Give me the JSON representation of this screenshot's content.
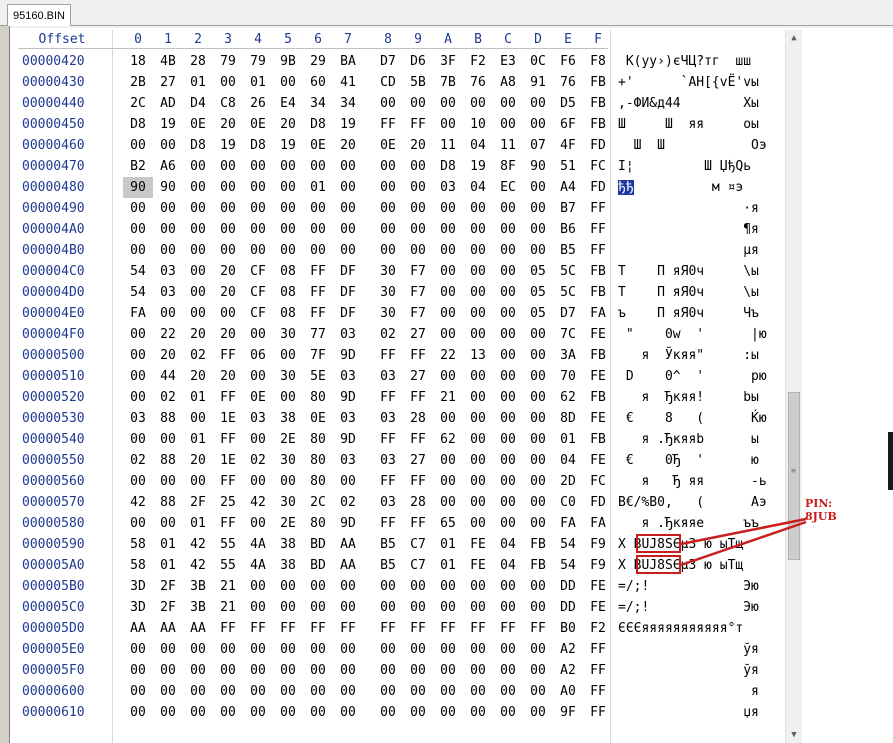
{
  "tab": {
    "label": "95160.BIN"
  },
  "header": {
    "offset_label": "Offset",
    "columns": [
      "0",
      "1",
      "2",
      "3",
      "4",
      "5",
      "6",
      "7",
      "8",
      "9",
      "A",
      "B",
      "C",
      "D",
      "E",
      "F"
    ]
  },
  "rows": [
    {
      "offset": "00000420",
      "bytes": [
        "18",
        "4B",
        "28",
        "79",
        "79",
        "9B",
        "29",
        "BA",
        "D7",
        "D6",
        "3F",
        "F2",
        "E3",
        "0C",
        "F6",
        "F8"
      ],
      "ascii": " K(yy›)єЧЦ?тг  шш"
    },
    {
      "offset": "00000430",
      "bytes": [
        "2B",
        "27",
        "01",
        "00",
        "01",
        "00",
        "60",
        "41",
        "CD",
        "5B",
        "7B",
        "76",
        "A8",
        "91",
        "76",
        "FB"
      ],
      "ascii": "+'      `AН[{vЁ'vы"
    },
    {
      "offset": "00000440",
      "bytes": [
        "2C",
        "AD",
        "D4",
        "C8",
        "26",
        "E4",
        "34",
        "34",
        "00",
        "00",
        "00",
        "00",
        "00",
        "00",
        "D5",
        "FB"
      ],
      "ascii": ",-ФИ&д44        Хы"
    },
    {
      "offset": "00000450",
      "bytes": [
        "D8",
        "19",
        "0E",
        "20",
        "0E",
        "20",
        "D8",
        "19",
        "FF",
        "FF",
        "00",
        "10",
        "00",
        "00",
        "6F",
        "FB"
      ],
      "ascii": "Ш     Ш  яя     оы"
    },
    {
      "offset": "00000460",
      "bytes": [
        "00",
        "00",
        "D8",
        "19",
        "D8",
        "19",
        "0E",
        "20",
        "0E",
        "20",
        "11",
        "04",
        "11",
        "07",
        "4F",
        "FD"
      ],
      "ascii": "  Ш  Ш           Оэ"
    },
    {
      "offset": "00000470",
      "bytes": [
        "B2",
        "A6",
        "00",
        "00",
        "00",
        "00",
        "00",
        "00",
        "00",
        "00",
        "D8",
        "19",
        "8F",
        "90",
        "51",
        "FC"
      ],
      "ascii": "І¦         Ш ЏђQь"
    },
    {
      "offset": "00000480",
      "bytes": [
        "90",
        "90",
        "00",
        "00",
        "00",
        "00",
        "01",
        "00",
        "00",
        "00",
        "03",
        "04",
        "EC",
        "00",
        "A4",
        "FD"
      ],
      "ascii": "ђђ          м ¤э"
    },
    {
      "offset": "00000490",
      "bytes": [
        "00",
        "00",
        "00",
        "00",
        "00",
        "00",
        "00",
        "00",
        "00",
        "00",
        "00",
        "00",
        "00",
        "00",
        "B7",
        "FF"
      ],
      "ascii": "                ·я"
    },
    {
      "offset": "000004A0",
      "bytes": [
        "00",
        "00",
        "00",
        "00",
        "00",
        "00",
        "00",
        "00",
        "00",
        "00",
        "00",
        "00",
        "00",
        "00",
        "B6",
        "FF"
      ],
      "ascii": "                ¶я"
    },
    {
      "offset": "000004B0",
      "bytes": [
        "00",
        "00",
        "00",
        "00",
        "00",
        "00",
        "00",
        "00",
        "00",
        "00",
        "00",
        "00",
        "00",
        "00",
        "B5",
        "FF"
      ],
      "ascii": "                µя"
    },
    {
      "offset": "000004C0",
      "bytes": [
        "54",
        "03",
        "00",
        "20",
        "CF",
        "08",
        "FF",
        "DF",
        "30",
        "F7",
        "00",
        "00",
        "00",
        "05",
        "5C",
        "FB"
      ],
      "ascii": "T    П яЯ0ч     \\ы"
    },
    {
      "offset": "000004D0",
      "bytes": [
        "54",
        "03",
        "00",
        "20",
        "CF",
        "08",
        "FF",
        "DF",
        "30",
        "F7",
        "00",
        "00",
        "00",
        "05",
        "5C",
        "FB"
      ],
      "ascii": "T    П яЯ0ч     \\ы"
    },
    {
      "offset": "000004E0",
      "bytes": [
        "FA",
        "00",
        "00",
        "00",
        "CF",
        "08",
        "FF",
        "DF",
        "30",
        "F7",
        "00",
        "00",
        "00",
        "05",
        "D7",
        "FA"
      ],
      "ascii": "ъ    П яЯ0ч     Чъ"
    },
    {
      "offset": "000004F0",
      "bytes": [
        "00",
        "22",
        "20",
        "20",
        "00",
        "30",
        "77",
        "03",
        "02",
        "27",
        "00",
        "00",
        "00",
        "00",
        "7C",
        "FE"
      ],
      "ascii": " \"    0w  '      |ю"
    },
    {
      "offset": "00000500",
      "bytes": [
        "00",
        "20",
        "02",
        "FF",
        "06",
        "00",
        "7F",
        "9D",
        "FF",
        "FF",
        "22",
        "13",
        "00",
        "00",
        "3A",
        "FB"
      ],
      "ascii": "   я  Ўкяя\"     :ы"
    },
    {
      "offset": "00000510",
      "bytes": [
        "00",
        "44",
        "20",
        "20",
        "00",
        "30",
        "5E",
        "03",
        "03",
        "27",
        "00",
        "00",
        "00",
        "00",
        "70",
        "FE"
      ],
      "ascii": " D    0^  '      рю"
    },
    {
      "offset": "00000520",
      "bytes": [
        "00",
        "02",
        "01",
        "FF",
        "0E",
        "00",
        "80",
        "9D",
        "FF",
        "FF",
        "21",
        "00",
        "00",
        "00",
        "62",
        "FB"
      ],
      "ascii": "   я  Ђкяя!     bы"
    },
    {
      "offset": "00000530",
      "bytes": [
        "03",
        "88",
        "00",
        "1E",
        "03",
        "38",
        "0E",
        "03",
        "03",
        "28",
        "00",
        "00",
        "00",
        "00",
        "8D",
        "FE"
      ],
      "ascii": " €    8   (      Ќю"
    },
    {
      "offset": "00000540",
      "bytes": [
        "00",
        "00",
        "01",
        "FF",
        "00",
        "2E",
        "80",
        "9D",
        "FF",
        "FF",
        "62",
        "00",
        "00",
        "00",
        "01",
        "FB"
      ],
      "ascii": "   я .Ђкяяb      ы"
    },
    {
      "offset": "00000550",
      "bytes": [
        "02",
        "88",
        "20",
        "1E",
        "02",
        "30",
        "80",
        "03",
        "03",
        "27",
        "00",
        "00",
        "00",
        "00",
        "04",
        "FE"
      ],
      "ascii": " €    0Ђ  '      ю"
    },
    {
      "offset": "00000560",
      "bytes": [
        "00",
        "00",
        "00",
        "FF",
        "00",
        "00",
        "80",
        "00",
        "FF",
        "FF",
        "00",
        "00",
        "00",
        "00",
        "2D",
        "FC"
      ],
      "ascii": "   я   Ђ яя      -ь"
    },
    {
      "offset": "00000570",
      "bytes": [
        "42",
        "88",
        "2F",
        "25",
        "42",
        "30",
        "2C",
        "02",
        "03",
        "28",
        "00",
        "00",
        "00",
        "00",
        "C0",
        "FD"
      ],
      "ascii": "B€/%B0,   (      Аэ"
    },
    {
      "offset": "00000580",
      "bytes": [
        "00",
        "00",
        "01",
        "FF",
        "00",
        "2E",
        "80",
        "9D",
        "FF",
        "FF",
        "65",
        "00",
        "00",
        "00",
        "FA",
        "FA"
      ],
      "ascii": "   я .Ђкяяе     ъъ"
    },
    {
      "offset": "00000590",
      "bytes": [
        "58",
        "01",
        "42",
        "55",
        "4A",
        "38",
        "BD",
        "AA",
        "B5",
        "C7",
        "01",
        "FE",
        "04",
        "FB",
        "54",
        "F9"
      ],
      "ascii": "X BUJ8ЅЄµЗ ю ыTщ"
    },
    {
      "offset": "000005A0",
      "bytes": [
        "58",
        "01",
        "42",
        "55",
        "4A",
        "38",
        "BD",
        "AA",
        "B5",
        "C7",
        "01",
        "FE",
        "04",
        "FB",
        "54",
        "F9"
      ],
      "ascii": "X BUJ8ЅЄµЗ ю ыTщ"
    },
    {
      "offset": "000005B0",
      "bytes": [
        "3D",
        "2F",
        "3B",
        "21",
        "00",
        "00",
        "00",
        "00",
        "00",
        "00",
        "00",
        "00",
        "00",
        "00",
        "DD",
        "FE"
      ],
      "ascii": "=/;!            Эю"
    },
    {
      "offset": "000005C0",
      "bytes": [
        "3D",
        "2F",
        "3B",
        "21",
        "00",
        "00",
        "00",
        "00",
        "00",
        "00",
        "00",
        "00",
        "00",
        "00",
        "DD",
        "FE"
      ],
      "ascii": "=/;!            Эю"
    },
    {
      "offset": "000005D0",
      "bytes": [
        "AA",
        "AA",
        "AA",
        "FF",
        "FF",
        "FF",
        "FF",
        "FF",
        "FF",
        "FF",
        "FF",
        "FF",
        "FF",
        "FF",
        "B0",
        "F2"
      ],
      "ascii": "ЄЄЄяяяяяяяяяяя°т"
    },
    {
      "offset": "000005E0",
      "bytes": [
        "00",
        "00",
        "00",
        "00",
        "00",
        "00",
        "00",
        "00",
        "00",
        "00",
        "00",
        "00",
        "00",
        "00",
        "A2",
        "FF"
      ],
      "ascii": "                ўя"
    },
    {
      "offset": "000005F0",
      "bytes": [
        "00",
        "00",
        "00",
        "00",
        "00",
        "00",
        "00",
        "00",
        "00",
        "00",
        "00",
        "00",
        "00",
        "00",
        "A2",
        "FF"
      ],
      "ascii": "                ўя"
    },
    {
      "offset": "00000600",
      "bytes": [
        "00",
        "00",
        "00",
        "00",
        "00",
        "00",
        "00",
        "00",
        "00",
        "00",
        "00",
        "00",
        "00",
        "00",
        "A0",
        "FF"
      ],
      "ascii": "                 я"
    },
    {
      "offset": "00000610",
      "bytes": [
        "00",
        "00",
        "00",
        "00",
        "00",
        "00",
        "00",
        "00",
        "00",
        "00",
        "00",
        "00",
        "00",
        "00",
        "9F",
        "FF"
      ],
      "ascii": "                џя"
    }
  ],
  "annotation": {
    "line1": "PIN:",
    "line2": "8JUB"
  },
  "colors": {
    "annotation": "#c81e1e",
    "offset_text": "#1f3a93",
    "selection": "#1a3aa0"
  },
  "scrollbar": {
    "up_icon": "▲",
    "down_icon": "▼",
    "grip": "≡"
  }
}
